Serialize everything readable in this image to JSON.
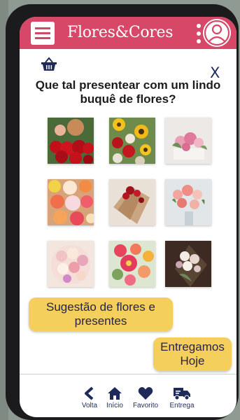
{
  "header": {
    "brand": "Flores&Cores",
    "brand_color": "#d64768"
  },
  "content": {
    "question": "Que tal presentear com um lindo buquê de flores?",
    "close_label": "X"
  },
  "gallery": {
    "images": [
      "red-roses-bouquet",
      "mixed-sunflower-roses-bouquet",
      "pink-roses-box",
      "gerbera-daisy-bouquet",
      "wrapped-red-roses",
      "pink-roses-vase",
      "pastel-roses-bouquet",
      "pink-dahlia-bouquet",
      "white-roses-wrapped"
    ]
  },
  "buttons": {
    "suggestion": "Sugestão de flores e presentes",
    "delivery": "Entregamos Hoje",
    "button_color": "#f5cf5c"
  },
  "nav": {
    "items": [
      {
        "label": "Volta",
        "icon": "chevron-left-icon"
      },
      {
        "label": "Início",
        "icon": "home-icon"
      },
      {
        "label": "Favorito",
        "icon": "heart-icon"
      },
      {
        "label": "Entrega",
        "icon": "delivery-truck-icon"
      }
    ]
  }
}
